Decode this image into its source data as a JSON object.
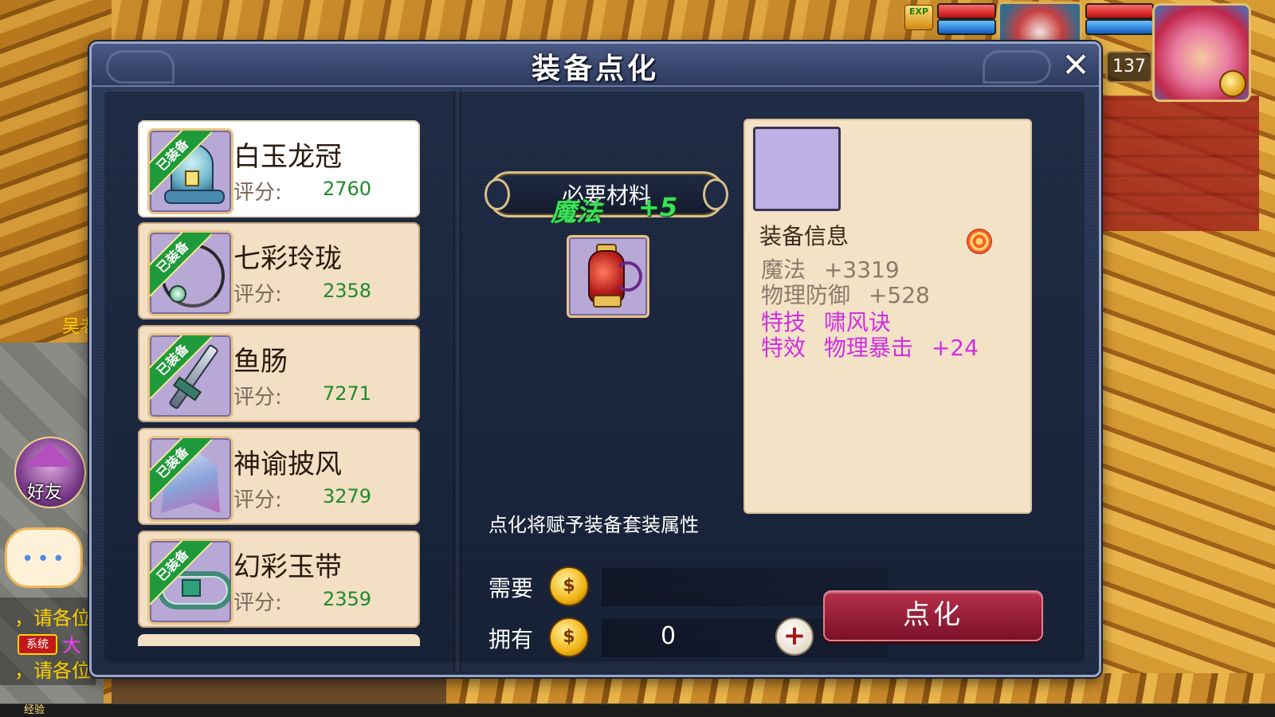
{
  "dialog": {
    "title": "装备点化",
    "close_glyph": "✕"
  },
  "equipment": [
    {
      "name": "白玉龙冠",
      "score_label": "评分:",
      "score": "2760",
      "tag": "已装备",
      "selected": true,
      "art": "crown"
    },
    {
      "name": "七彩玲珑",
      "score_label": "评分:",
      "score": "2358",
      "tag": "已装备",
      "selected": false,
      "art": "necklace"
    },
    {
      "name": "鱼肠",
      "score_label": "评分:",
      "score": "7271",
      "tag": "已装备",
      "selected": false,
      "art": "dagger"
    },
    {
      "name": "神谕披风",
      "score_label": "评分:",
      "score": "3279",
      "tag": "已装备",
      "selected": false,
      "art": "cloak"
    },
    {
      "name": "幻彩玉带",
      "score_label": "评分:",
      "score": "2359",
      "tag": "已装备",
      "selected": false,
      "art": "belt"
    }
  ],
  "material": {
    "banner_label": "必要材料",
    "float_attr": "魔法",
    "float_value": "+5",
    "item_icon": "vase-icon"
  },
  "refine": {
    "note": "点化将赋予装备套装属性",
    "need_label": "需要",
    "have_label": "拥有",
    "have_value": "0",
    "add_glyph": "+",
    "button_label": "点化"
  },
  "info": {
    "title": "装备信息",
    "lines": [
      {
        "label": "魔法",
        "value": "+3319"
      },
      {
        "label": "物理防御",
        "value": "+528"
      },
      {
        "label": "特技",
        "value": "啸风诀"
      },
      {
        "label": "特效",
        "value": "物理暴击",
        "extra": "+24"
      }
    ]
  },
  "hud": {
    "level": "137",
    "exp_icon_label": "EXP",
    "exp_bar_label": "经验"
  },
  "side": {
    "npc_name": "吴老",
    "friend_label": "好友",
    "chat_dots": "•••",
    "chat_lines": [
      "，请各位",
      "大",
      "，请各位"
    ],
    "system_tag": "系统"
  },
  "colors": {
    "panel_bg": "#2c3a5a",
    "item_card": "#f2dfc4",
    "score_green": "#1f8a2a",
    "special_magenta": "#d02ee0",
    "refine_button": "#9a2038",
    "equipped_ribbon": "#1f9a3a"
  }
}
